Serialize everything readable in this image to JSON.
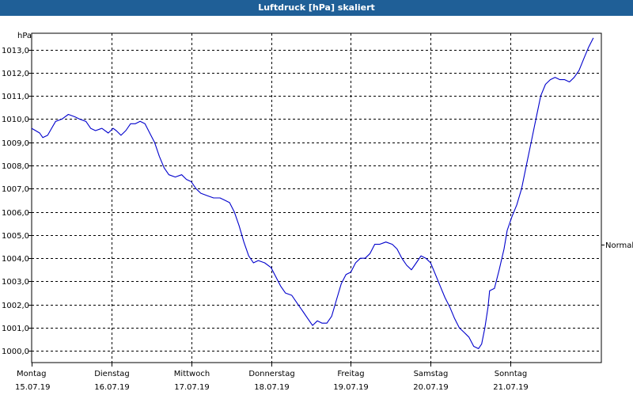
{
  "window": {
    "title": "Luftdruck [hPa] skaliert"
  },
  "colors": {
    "titlebar": "#1f5f97",
    "line": "#0000cc",
    "grid": "#000000"
  },
  "chart_data": {
    "type": "line",
    "title": "Luftdruck [hPa] skaliert",
    "ylabel": "hPa",
    "ylim": [
      999.5,
      1013.7
    ],
    "yticks": [
      "1000,0",
      "1001,0",
      "1002,0",
      "1003,0",
      "1004,0",
      "1005,0",
      "1006,0",
      "1007,0",
      "1008,0",
      "1009,0",
      "1010,0",
      "1011,0",
      "1012,0",
      "1013,0"
    ],
    "xlim": [
      0,
      7.14
    ],
    "xticks": [
      {
        "x": 0,
        "day": "Montag",
        "date": "15.07.19"
      },
      {
        "x": 1,
        "day": "Dienstag",
        "date": "16.07.19"
      },
      {
        "x": 2,
        "day": "Mittwoch",
        "date": "17.07.19"
      },
      {
        "x": 3,
        "day": "Donnerstag",
        "date": "18.07.19"
      },
      {
        "x": 4,
        "day": "Freitag",
        "date": "19.07.19"
      },
      {
        "x": 5,
        "day": "Samstag",
        "date": "20.07.19"
      },
      {
        "x": 6,
        "day": "Sonntag",
        "date": "21.07.19"
      }
    ],
    "grid": true,
    "reference": {
      "label": "Normal",
      "value": 1004.6
    },
    "series": [
      {
        "values": [
          [
            0.0,
            1009.6
          ],
          [
            0.05,
            1009.5
          ],
          [
            0.1,
            1009.4
          ],
          [
            0.14,
            1009.2
          ],
          [
            0.2,
            1009.3
          ],
          [
            0.25,
            1009.6
          ],
          [
            0.3,
            1009.9
          ],
          [
            0.38,
            1010.0
          ],
          [
            0.46,
            1010.2
          ],
          [
            0.54,
            1010.1
          ],
          [
            0.6,
            1010.0
          ],
          [
            0.68,
            1009.9
          ],
          [
            0.74,
            1009.6
          ],
          [
            0.8,
            1009.5
          ],
          [
            0.88,
            1009.6
          ],
          [
            0.96,
            1009.4
          ],
          [
            1.02,
            1009.6
          ],
          [
            1.06,
            1009.5
          ],
          [
            1.12,
            1009.3
          ],
          [
            1.18,
            1009.5
          ],
          [
            1.24,
            1009.8
          ],
          [
            1.3,
            1009.8
          ],
          [
            1.36,
            1009.9
          ],
          [
            1.42,
            1009.8
          ],
          [
            1.48,
            1009.4
          ],
          [
            1.54,
            1009.0
          ],
          [
            1.6,
            1008.4
          ],
          [
            1.66,
            1007.9
          ],
          [
            1.72,
            1007.6
          ],
          [
            1.8,
            1007.5
          ],
          [
            1.88,
            1007.6
          ],
          [
            1.94,
            1007.4
          ],
          [
            2.0,
            1007.3
          ],
          [
            2.06,
            1007.0
          ],
          [
            2.12,
            1006.8
          ],
          [
            2.2,
            1006.7
          ],
          [
            2.28,
            1006.6
          ],
          [
            2.36,
            1006.6
          ],
          [
            2.42,
            1006.5
          ],
          [
            2.48,
            1006.4
          ],
          [
            2.54,
            1006.0
          ],
          [
            2.6,
            1005.4
          ],
          [
            2.66,
            1004.7
          ],
          [
            2.72,
            1004.1
          ],
          [
            2.78,
            1003.8
          ],
          [
            2.84,
            1003.9
          ],
          [
            2.92,
            1003.8
          ],
          [
            3.0,
            1003.6
          ],
          [
            3.06,
            1003.2
          ],
          [
            3.12,
            1002.8
          ],
          [
            3.18,
            1002.5
          ],
          [
            3.26,
            1002.4
          ],
          [
            3.34,
            1002.0
          ],
          [
            3.4,
            1001.7
          ],
          [
            3.46,
            1001.4
          ],
          [
            3.52,
            1001.1
          ],
          [
            3.58,
            1001.3
          ],
          [
            3.64,
            1001.2
          ],
          [
            3.7,
            1001.2
          ],
          [
            3.76,
            1001.5
          ],
          [
            3.82,
            1002.2
          ],
          [
            3.88,
            1002.9
          ],
          [
            3.94,
            1003.3
          ],
          [
            4.0,
            1003.4
          ],
          [
            4.06,
            1003.8
          ],
          [
            4.12,
            1004.0
          ],
          [
            4.18,
            1004.0
          ],
          [
            4.24,
            1004.2
          ],
          [
            4.3,
            1004.6
          ],
          [
            4.36,
            1004.6
          ],
          [
            4.44,
            1004.7
          ],
          [
            4.52,
            1004.6
          ],
          [
            4.58,
            1004.4
          ],
          [
            4.64,
            1004.0
          ],
          [
            4.7,
            1003.7
          ],
          [
            4.76,
            1003.5
          ],
          [
            4.82,
            1003.8
          ],
          [
            4.88,
            1004.1
          ],
          [
            4.94,
            1004.0
          ],
          [
            5.0,
            1003.8
          ],
          [
            5.06,
            1003.3
          ],
          [
            5.12,
            1002.8
          ],
          [
            5.18,
            1002.3
          ],
          [
            5.24,
            1001.9
          ],
          [
            5.3,
            1001.4
          ],
          [
            5.36,
            1001.0
          ],
          [
            5.42,
            1000.8
          ],
          [
            5.48,
            1000.6
          ],
          [
            5.54,
            1000.2
          ],
          [
            5.6,
            1000.1
          ],
          [
            5.64,
            1000.3
          ],
          [
            5.68,
            1001.0
          ],
          [
            5.72,
            1001.9
          ],
          [
            5.74,
            1002.6
          ],
          [
            5.8,
            1002.7
          ],
          [
            5.86,
            1003.5
          ],
          [
            5.92,
            1004.4
          ],
          [
            5.96,
            1005.2
          ],
          [
            6.02,
            1005.8
          ],
          [
            6.08,
            1006.3
          ],
          [
            6.14,
            1007.0
          ],
          [
            6.2,
            1008.0
          ],
          [
            6.26,
            1009.0
          ],
          [
            6.32,
            1010.0
          ],
          [
            6.38,
            1011.0
          ],
          [
            6.44,
            1011.5
          ],
          [
            6.5,
            1011.7
          ],
          [
            6.56,
            1011.8
          ],
          [
            6.62,
            1011.7
          ],
          [
            6.68,
            1011.7
          ],
          [
            6.74,
            1011.6
          ],
          [
            6.8,
            1011.8
          ],
          [
            6.86,
            1012.1
          ],
          [
            6.92,
            1012.6
          ],
          [
            6.98,
            1013.1
          ],
          [
            7.04,
            1013.5
          ]
        ]
      }
    ]
  }
}
